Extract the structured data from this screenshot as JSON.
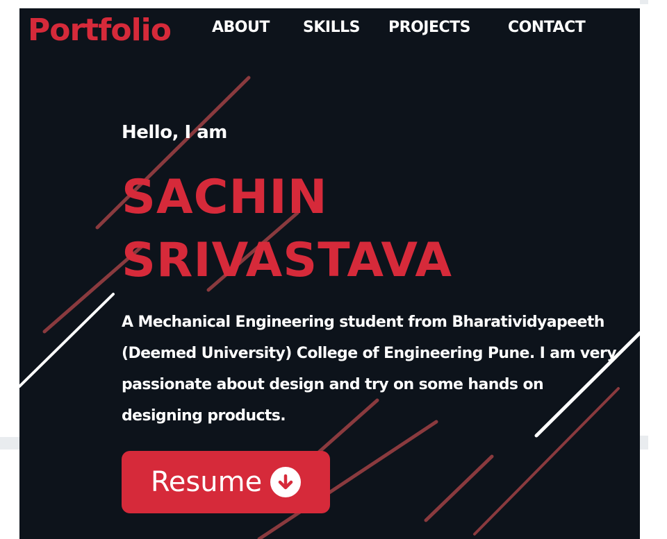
{
  "nav": {
    "brand": "Portfolio",
    "links": [
      "ABOUT",
      "SKILLS",
      "PROJECTS",
      "CONTACT"
    ]
  },
  "hero": {
    "greeting": "Hello, I am",
    "name_first": "SACHIN",
    "name_last": "SRIVASTAVA",
    "bio": "A Mechanical Engineering student from Bharatividyapeeth (Deemed University) College of Engineering Pune. I am very passionate about design and try on some hands on designing products.",
    "resume_label": "Resume",
    "resume_icon": "arrow-down-circle-icon"
  },
  "colors": {
    "accent": "#d62a3a",
    "background": "#0d131b",
    "text": "#ffffff",
    "deco_line": "#8a3a3e"
  }
}
